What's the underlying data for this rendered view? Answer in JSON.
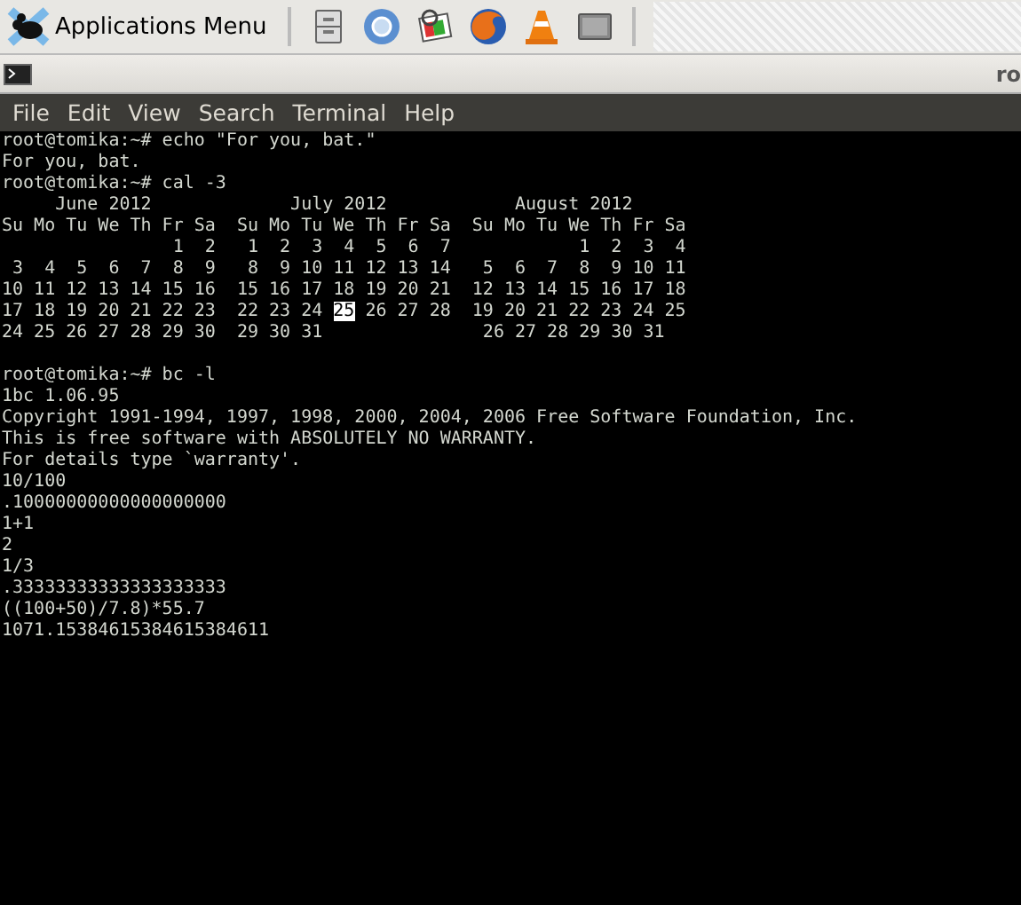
{
  "panel": {
    "app_menu": "Applications Menu",
    "launchers": [
      {
        "kind": "cabinet"
      },
      {
        "kind": "sphere"
      },
      {
        "kind": "photo"
      },
      {
        "kind": "globe"
      },
      {
        "kind": "cone"
      },
      {
        "kind": "screen"
      }
    ]
  },
  "window": {
    "title": "ro"
  },
  "menubar": [
    "File",
    "Edit",
    "View",
    "Search",
    "Terminal",
    "Help"
  ],
  "terminal": {
    "blocks": [
      [
        "root@tomika:~# echo \"For you, bat.\"",
        "For you, bat.",
        "root@tomika:~# cal -3",
        "     June 2012             July 2012            August 2012",
        "Su Mo Tu We Th Fr Sa  Su Mo Tu We Th Fr Sa  Su Mo Tu We Th Fr Sa",
        "                1  2   1  2  3  4  5  6  7            1  2  3  4",
        " 3  4  5  6  7  8  9   8  9 10 11 12 13 14   5  6  7  8  9 10 11",
        "10 11 12 13 14 15 16  15 16 17 18 19 20 21  12 13 14 15 16 17 18",
        {
          "spans": [
            {
              "text": "17 18 19 20 21 22 23  22 23 24 ",
              "highlighted": false
            },
            {
              "text": "25",
              "highlighted": true
            },
            {
              "text": " 26 27 28  19 20 21 22 23 24 25",
              "highlighted": false
            }
          ]
        },
        "24 25 26 27 28 29 30  29 30 31               26 27 28 29 30 31"
      ],
      [
        "root@tomika:~# bc -l",
        "1bc 1.06.95",
        "Copyright 1991-1994, 1997, 1998, 2000, 2004, 2006 Free Software Foundation, Inc.",
        "This is free software with ABSOLUTELY NO WARRANTY.",
        "For details type `warranty'.",
        "10/100",
        ".10000000000000000000",
        "1+1",
        "2",
        "1/3",
        ".33333333333333333333",
        "((100+50)/7.8)*55.7",
        "1071.15384615384615384611"
      ]
    ]
  }
}
